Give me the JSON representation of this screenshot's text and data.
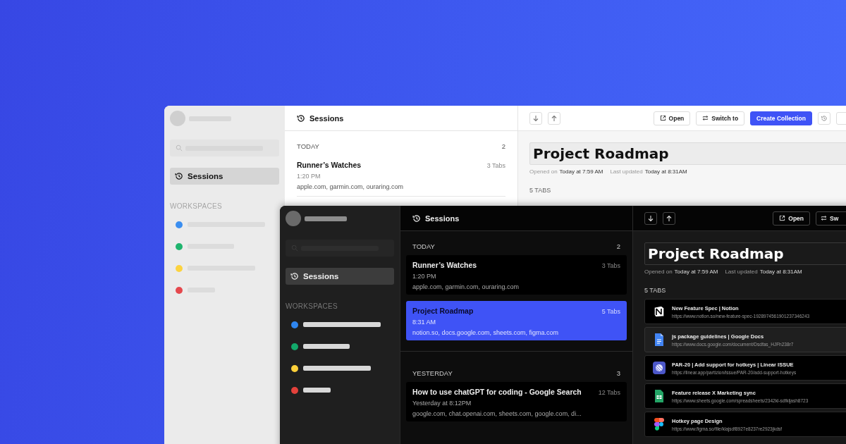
{
  "windows": [
    {
      "kind": "light",
      "sidebar": {
        "nav": [
          {
            "label": "Sessions",
            "selected": true
          }
        ],
        "section_title": "WORKSPACES",
        "workspaces": [
          {
            "color": "#3b8ef0"
          },
          {
            "color": "#1fb46e"
          },
          {
            "color": "#fcd33f"
          },
          {
            "color": "#e5484d"
          }
        ]
      },
      "sessions": {
        "title": "Sessions",
        "groups": [
          {
            "label": "TODAY",
            "count": "2",
            "items": [
              {
                "title": "Runner’s Watches",
                "tabs": "3 Tabs",
                "time": "1:20 PM",
                "domains": "apple.com, garmin.com, ouraring.com",
                "selected": false
              }
            ]
          }
        ]
      },
      "detail": {
        "buttons": [
          {
            "kind": "open",
            "label": "Open"
          },
          {
            "kind": "switch",
            "label": "Switch to"
          },
          {
            "kind": "create",
            "label": "Create Collection"
          },
          {
            "kind": "history"
          },
          {
            "kind": "blank"
          }
        ],
        "title": "Project Roadmap",
        "meta": [
          {
            "label": "Opened on",
            "value": "Today at 7:59 AM"
          },
          {
            "label": "Last updated",
            "value": "Today at 8:31AM"
          }
        ],
        "tabs_heading": "5 TABS"
      }
    },
    {
      "kind": "dark",
      "sidebar": {
        "nav": [
          {
            "label": "Sessions",
            "selected": true
          }
        ],
        "section_title": "WORKSPACES",
        "workspaces": [
          {
            "color": "#2f86f0"
          },
          {
            "color": "#12a86a"
          },
          {
            "color": "#fcd03a"
          },
          {
            "color": "#e3413b"
          }
        ]
      },
      "sessions": {
        "title": "Sessions",
        "groups": [
          {
            "label": "TODAY",
            "count": "2",
            "items": [
              {
                "title": "Runner’s Watches",
                "tabs": "3 Tabs",
                "time": "1:20 PM",
                "domains": "apple.com, garmin.com, ouraring.com",
                "selected": false
              },
              {
                "title": "Project Roadmap",
                "tabs": "5 Tabs",
                "time": "8:31 AM",
                "domains": "notion.so, docs.google.com, sheets.com, figma.com",
                "selected": true
              }
            ]
          },
          {
            "label": "YESTERDAY",
            "count": "3",
            "items": [
              {
                "title": "How to use chatGPT for coding - Google Search",
                "tabs": "12 Tabs",
                "time": "Yesterday at 8:12PM",
                "domains": "google.com, chat.openai.com, sheets.com, google.com, di...",
                "selected": false
              }
            ]
          }
        ]
      },
      "detail": {
        "buttons": [
          {
            "kind": "open",
            "label": "Open"
          },
          {
            "kind": "switch",
            "label": "Sw"
          }
        ],
        "title": "Project Roadmap",
        "meta": [
          {
            "label": "Opened on",
            "value": "Today at 7:59 AM"
          },
          {
            "label": "Last updated",
            "value": "Today at 8:31AM"
          }
        ],
        "tabs_heading": "5 TABS",
        "tabs": [
          {
            "kind": "notion",
            "title": "New Feature Spec | Notion",
            "url": "https://www.notion.so/new-feature-spec-1928974561901237346243",
            "selected": false
          },
          {
            "kind": "docs",
            "title": "js package guidelines | Google Docs",
            "url": "https://www.docs.google.com/document/Dsdfas_HJFh238r7",
            "selected": true
          },
          {
            "kind": "linear",
            "title": "PAR-20 | Add support for hotkeys | Linear ISSUE",
            "url": "https://linear.app/partizion/issue/PAR-20/add-support-hotkeys",
            "selected": false
          },
          {
            "kind": "sheets",
            "title": "Feature release X Marketing sync",
            "url": "https://www.sheets.google.com/spreadsheets/2342kl-sdfkljash8723",
            "selected": false
          },
          {
            "kind": "figma",
            "title": "Hotkey page Design",
            "url": "https://www.figma.so/file/klajsdf8927e8237re2923jkdsf",
            "selected": false
          }
        ]
      }
    }
  ]
}
